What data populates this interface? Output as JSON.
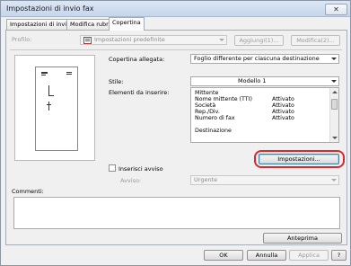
{
  "window": {
    "title": "Impostazioni di invio fax",
    "close_glyph": "✕"
  },
  "tabs": [
    {
      "label": "Impostazioni di invio"
    },
    {
      "label": "Modifica rubrica"
    },
    {
      "label": "Copertina"
    }
  ],
  "profile": {
    "label": "Profilo:",
    "value": "Impostazioni predefinite",
    "icon": "profile-icon",
    "add_label": "Aggiungi(1)...",
    "edit_label": "Modifica(2)..."
  },
  "cover": {
    "attached_label": "Copertina allegata:",
    "attached_value": "Foglio differente per ciascuna destinazione",
    "style_label": "Stile:",
    "style_value": "Modello 1",
    "elements_label": "Elementi da inserire:",
    "elements": [
      {
        "name": "Mittente",
        "status": ""
      },
      {
        "name": "Nome mittente (TTI)",
        "status": "Attivato"
      },
      {
        "name": "Società",
        "status": "Attivato"
      },
      {
        "name": "Rep./Div.",
        "status": "Attivato"
      },
      {
        "name": "Numero di fax",
        "status": "Attivato"
      },
      {
        "name": "",
        "status": ""
      },
      {
        "name": "Destinazione",
        "status": ""
      }
    ],
    "settings_button": "Impostazioni...",
    "insert_notice_label": "Inserisci avviso",
    "notice_label": "Avviso:",
    "notice_value": "Urgente",
    "comments_label": "Commenti:",
    "preview_button": "Anteprima"
  },
  "footer": {
    "ok": "OK",
    "cancel": "Annulla",
    "apply": "Applica",
    "help": "?"
  }
}
